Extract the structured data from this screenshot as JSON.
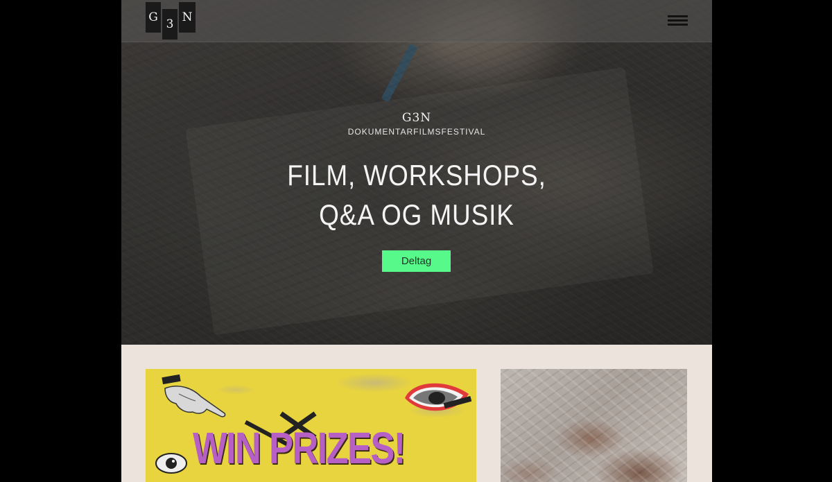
{
  "header": {
    "logo_letters": [
      "G",
      "3",
      "N"
    ],
    "menu_icon": "hamburger-menu-icon"
  },
  "hero": {
    "mini_logo": "G3N",
    "festival_label": "DOKUMENTARFILMSFESTIVAL",
    "headline_line1": "FILM, WORKSHOPS,",
    "headline_line2": "Q&A OG MUSIK",
    "cta_label": "Deltag"
  },
  "cards": [
    {
      "promo_text": "WIN PRIZES!"
    },
    {
      "image": "crumpled-paper-image"
    }
  ],
  "colors": {
    "cta_bg": "#57f98a",
    "promo_bg": "#e8d43e",
    "promo_text": "#b65fc4",
    "section_bg": "#ece4dc",
    "page_bg": "#000000"
  }
}
